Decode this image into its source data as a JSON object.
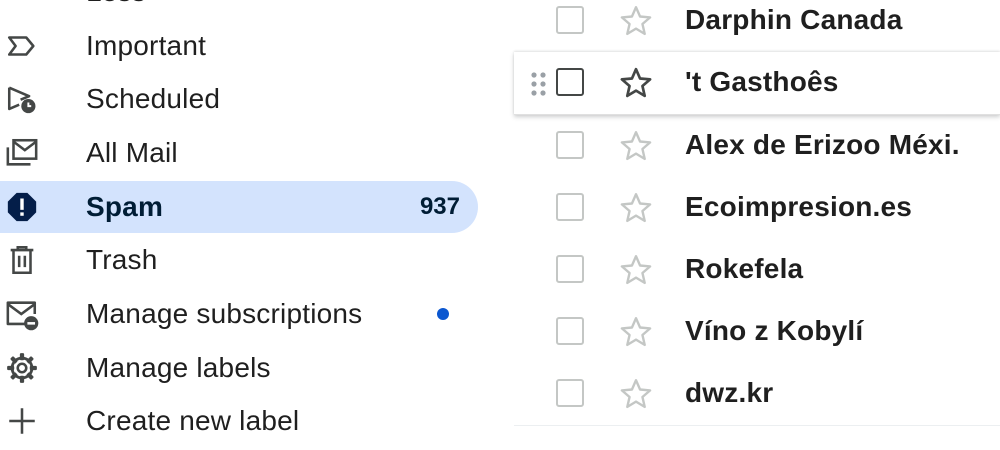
{
  "sidebar": {
    "items": [
      {
        "label": "Less",
        "icon": "chevron-up-icon"
      },
      {
        "label": "Important",
        "icon": "important-icon"
      },
      {
        "label": "Scheduled",
        "icon": "scheduled-icon"
      },
      {
        "label": "All Mail",
        "icon": "all-mail-icon"
      },
      {
        "label": "Spam",
        "icon": "spam-icon",
        "count": "937",
        "active": true
      },
      {
        "label": "Trash",
        "icon": "trash-icon"
      },
      {
        "label": "Manage subscriptions",
        "icon": "manage-subscriptions-icon",
        "has_dot": true
      },
      {
        "label": "Manage labels",
        "icon": "gear-icon"
      },
      {
        "label": "Create new label",
        "icon": "plus-icon"
      }
    ]
  },
  "emails": [
    {
      "sender": "Darphin Canada"
    },
    {
      "sender": "'t Gasthoês",
      "hovered": true
    },
    {
      "sender": "Alex de Erizoo Méxi."
    },
    {
      "sender": "Ecoimpresion.es"
    },
    {
      "sender": "Rokefela"
    },
    {
      "sender": "Víno z Kobylí"
    },
    {
      "sender": "dwz.kr"
    }
  ],
  "colors": {
    "active_bg": "#d3e3fd",
    "active_text": "#001d35",
    "dot": "#0b57d0",
    "spam_icon": "#041e49"
  }
}
